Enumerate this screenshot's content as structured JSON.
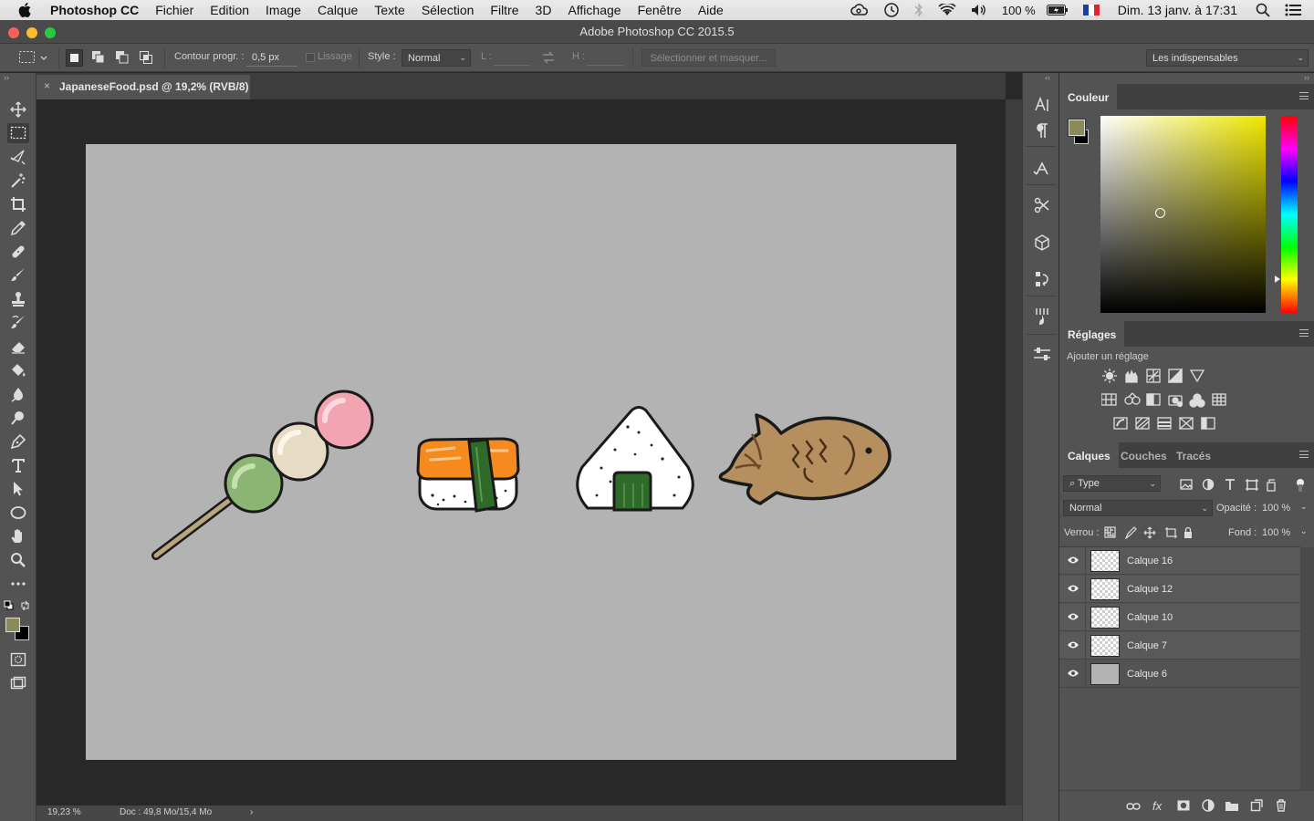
{
  "menubar": {
    "app_name": "Photoshop CC",
    "items": [
      "Fichier",
      "Edition",
      "Image",
      "Calque",
      "Texte",
      "Sélection",
      "Filtre",
      "3D",
      "Affichage",
      "Fenêtre",
      "Aide"
    ],
    "battery": "100 %",
    "clock": "Dim. 13 janv. à 17:31"
  },
  "window": {
    "title": "Adobe Photoshop CC 2015.5"
  },
  "options": {
    "feather_label": "Contour progr. :",
    "feather_value": "0,5 px",
    "antialias_label": "Lissage",
    "style_label": "Style :",
    "style_value": "Normal",
    "width_label": "L :",
    "height_label": "H :",
    "select_mask_label": "Sélectionner et masquer...",
    "workspace": "Les indispensables"
  },
  "document": {
    "tab_title": "JapaneseFood.psd @ 19,2% (RVB/8)",
    "zoom": "19,23 %",
    "doc_info": "Doc : 49,8 Mo/15,4 Mo"
  },
  "colors": {
    "foreground": "#8b8a5a",
    "background": "#000000",
    "canvas": "#b3b3b3",
    "hue_base": "#f0e800"
  },
  "color_panel": {
    "tab": "Couleur"
  },
  "adjustments_panel": {
    "tab": "Réglages",
    "subtitle": "Ajouter un réglage"
  },
  "layers_panel": {
    "tabs": [
      "Calques",
      "Couches",
      "Tracés"
    ],
    "filter_type": "Type",
    "blend_mode": "Normal",
    "opacity_label": "Opacité :",
    "opacity_value": "100 %",
    "lock_label": "Verrou :",
    "fill_label": "Fond :",
    "fill_value": "100 %",
    "layers": [
      {
        "name": "Calque 16"
      },
      {
        "name": "Calque 12"
      },
      {
        "name": "Calque 10"
      },
      {
        "name": "Calque 7"
      },
      {
        "name": "Calque 6"
      }
    ]
  },
  "toolbar_tools": [
    "move-tool",
    "marquee-tool",
    "lasso-tool",
    "magic-wand-tool",
    "crop-tool",
    "eyedropper-tool",
    "healing-brush-tool",
    "brush-tool",
    "clone-stamp-tool",
    "history-brush-tool",
    "eraser-tool",
    "paint-bucket-tool",
    "blur-tool",
    "dodge-tool",
    "pen-tool",
    "type-tool",
    "path-selection-tool",
    "ellipse-tool",
    "hand-tool",
    "zoom-tool",
    "more-tools"
  ]
}
